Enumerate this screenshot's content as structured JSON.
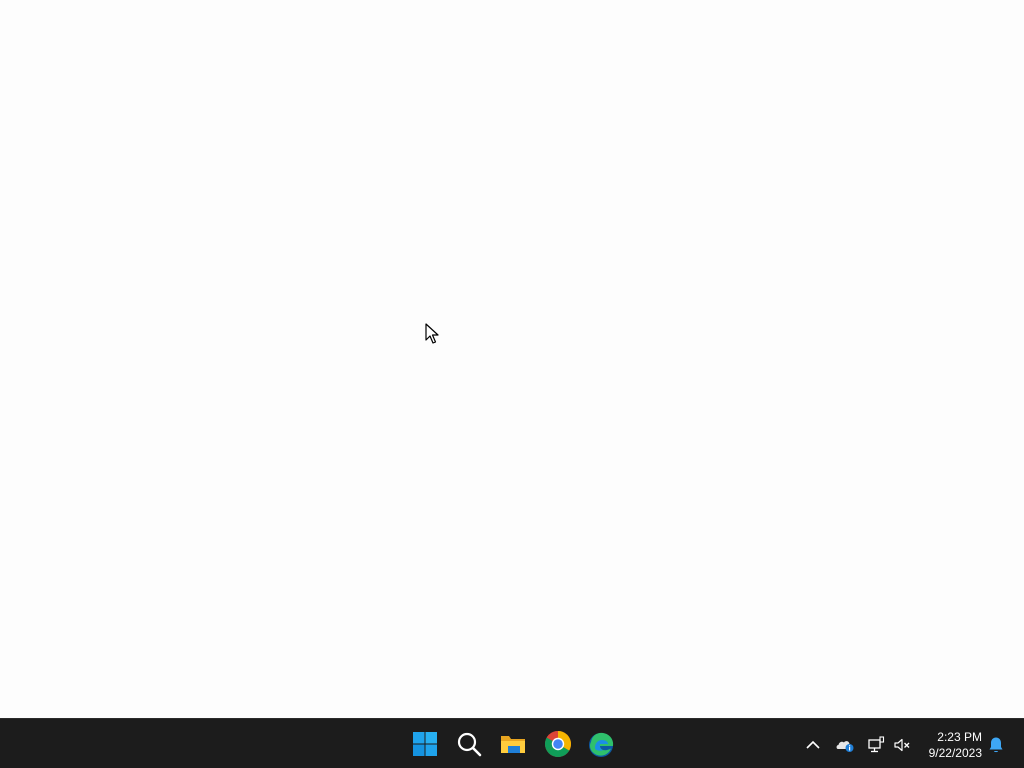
{
  "taskbar": {
    "pinned": [
      {
        "name": "Start",
        "icon": "windows-logo-icon"
      },
      {
        "name": "Search",
        "icon": "search-icon"
      },
      {
        "name": "File Explorer",
        "icon": "folder-icon"
      },
      {
        "name": "Google Chrome",
        "icon": "chrome-icon"
      },
      {
        "name": "Microsoft Edge",
        "icon": "edge-icon"
      }
    ],
    "tray": {
      "icons": [
        "chevron-up-icon",
        "onedrive-icon",
        "network-icon",
        "volume-muted-icon"
      ],
      "clock": {
        "time": "2:23 PM",
        "date": "9/22/2023"
      },
      "notification_icon": "bell-icon"
    }
  },
  "colors": {
    "desktop": "#fdfdfd",
    "taskbar": "#1c1c1c",
    "accent": "#0078d4",
    "notification": "#3ea7f5"
  }
}
